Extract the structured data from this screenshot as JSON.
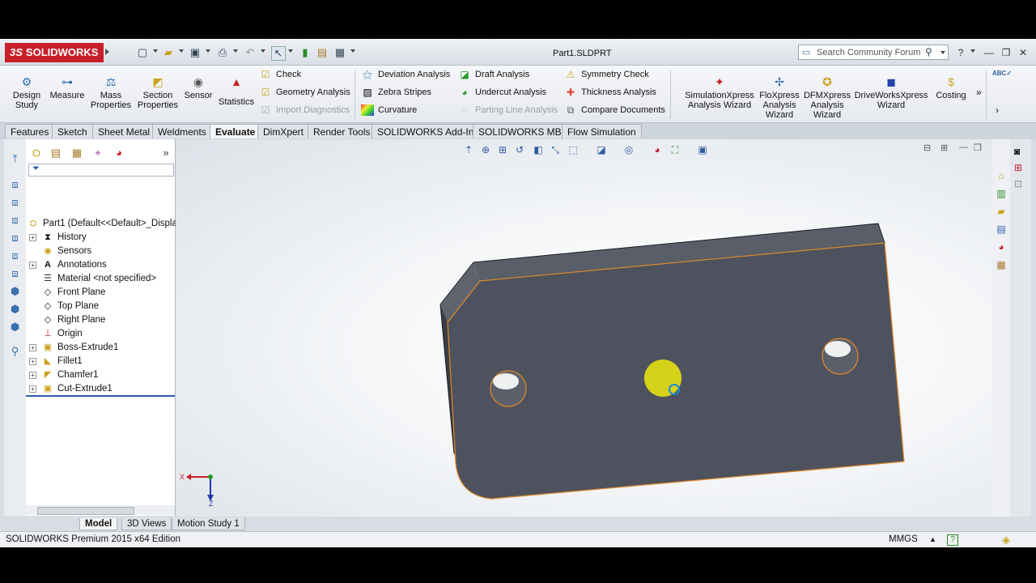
{
  "app": {
    "brand": "SOLIDWORKS",
    "brand_prefix": "3S",
    "document_title": "Part1.SLDPRT",
    "search_placeholder": "Search Community Forum"
  },
  "ribbon": {
    "big_buttons": [
      {
        "label": "Design Study",
        "icon": "design-study-icon"
      },
      {
        "label": "Measure",
        "icon": "measure-icon"
      },
      {
        "label": "Mass Properties",
        "icon": "mass-properties-icon"
      },
      {
        "label": "Section Properties",
        "icon": "section-properties-icon"
      },
      {
        "label": "Sensor",
        "icon": "sensor-icon"
      },
      {
        "label": "Statistics",
        "icon": "statistics-icon"
      }
    ],
    "col1": [
      {
        "label": "Check",
        "enabled": true
      },
      {
        "label": "Geometry Analysis",
        "enabled": true
      },
      {
        "label": "Import Diagnostics",
        "enabled": false
      }
    ],
    "col2": [
      {
        "label": "Deviation Analysis",
        "enabled": true
      },
      {
        "label": "Zebra Stripes",
        "enabled": true
      },
      {
        "label": "Curvature",
        "enabled": true
      }
    ],
    "col3": [
      {
        "label": "Draft Analysis",
        "enabled": true
      },
      {
        "label": "Undercut Analysis",
        "enabled": true
      },
      {
        "label": "Parting Line Analysis",
        "enabled": false
      }
    ],
    "col4": [
      {
        "label": "Symmetry Check",
        "enabled": true
      },
      {
        "label": "Thickness Analysis",
        "enabled": true
      },
      {
        "label": "Compare Documents",
        "enabled": true
      }
    ],
    "wizards": [
      {
        "label": "SimulationXpress Analysis Wizard"
      },
      {
        "label": "FloXpress Analysis Wizard"
      },
      {
        "label": "DFMXpress Analysis Wizard"
      },
      {
        "label": "DriveWorksXpress Wizard"
      },
      {
        "label": "Costing"
      }
    ]
  },
  "tabs": [
    "Features",
    "Sketch",
    "Sheet Metal",
    "Weldments",
    "Evaluate",
    "DimXpert",
    "Render Tools",
    "SOLIDWORKS Add-Ins",
    "SOLIDWORKS MBD",
    "Flow Simulation"
  ],
  "active_tab": "Evaluate",
  "tree": {
    "root": "Part1  (Default<<Default>_Displa",
    "items": [
      {
        "label": "History",
        "expandable": true
      },
      {
        "label": "Sensors",
        "expandable": false
      },
      {
        "label": "Annotations",
        "expandable": true
      },
      {
        "label": "Material <not specified>",
        "expandable": false
      },
      {
        "label": "Front Plane",
        "expandable": false
      },
      {
        "label": "Top Plane",
        "expandable": false
      },
      {
        "label": "Right Plane",
        "expandable": false
      },
      {
        "label": "Origin",
        "expandable": false
      },
      {
        "label": "Boss-Extrude1",
        "expandable": true
      },
      {
        "label": "Fillet1",
        "expandable": true
      },
      {
        "label": "Chamfer1",
        "expandable": true
      },
      {
        "label": "Cut-Extrude1",
        "expandable": true
      }
    ]
  },
  "bottom_tabs": [
    "Model",
    "3D Views",
    "Motion Study 1"
  ],
  "active_bottom_tab": "Model",
  "triad": {
    "x_label": "X",
    "z_label": "Z"
  },
  "status": {
    "edition": "SOLIDWORKS Premium 2015 x64 Edition",
    "units": "MMGS"
  },
  "colors": {
    "brand_red": "#c8202a",
    "part_face": "#4e525e",
    "part_side": "#3a3d46",
    "edge_highlight": "#e08a2a",
    "selection_yellow": "#d6d21a"
  }
}
